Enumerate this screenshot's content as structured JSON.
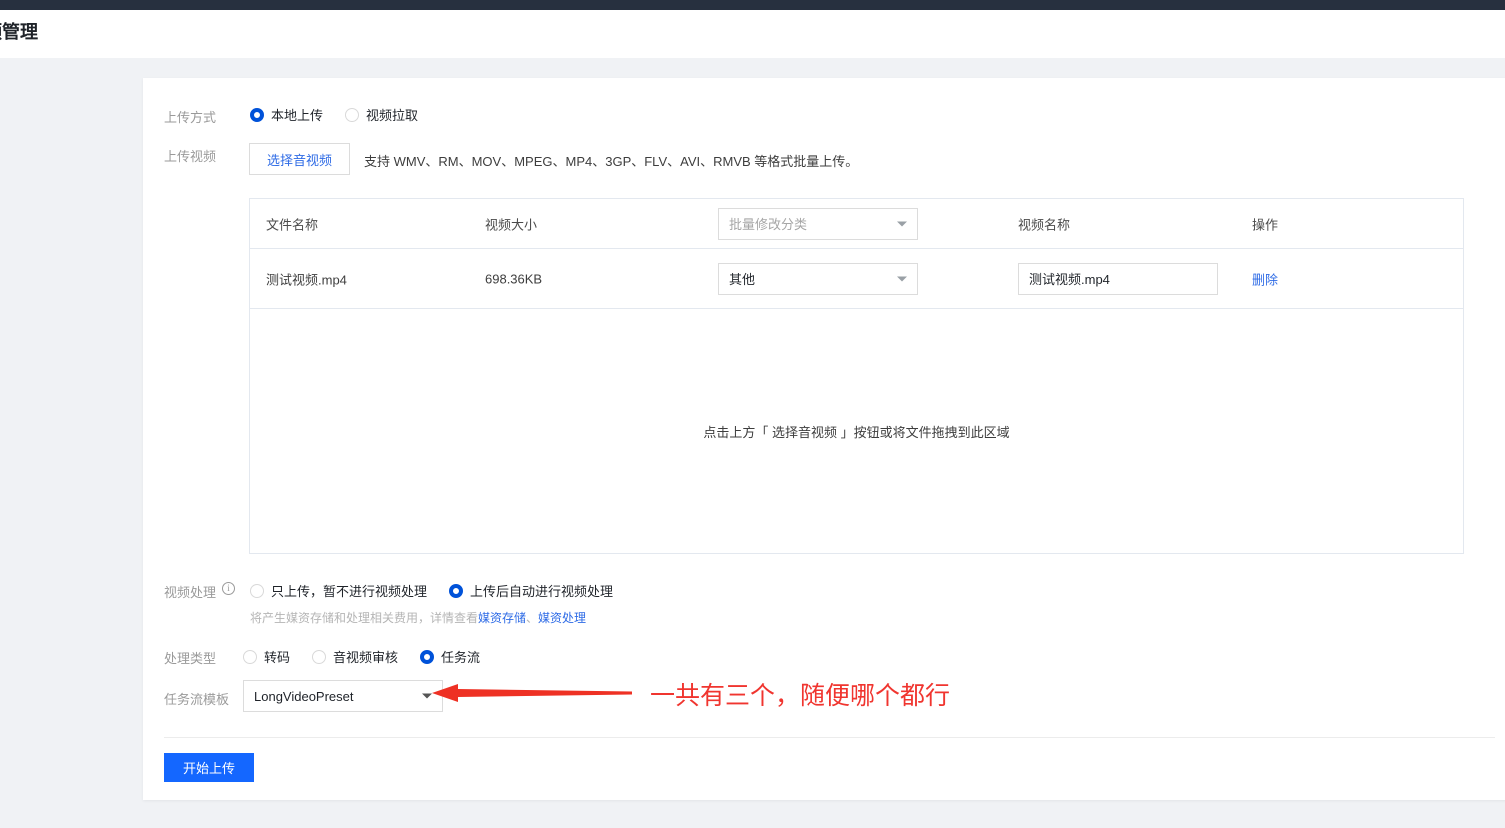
{
  "window": {
    "title": "频管理",
    "topbar_color": "#27303f",
    "page_bg": "#f0f2f5",
    "accent_color": "#1467ff",
    "link_color": "#2e6be6",
    "annotation_color": "#f0352f"
  },
  "form": {
    "upload_method": {
      "label": "上传方式",
      "options": [
        {
          "label": "本地上传",
          "selected": true
        },
        {
          "label": "视频拉取",
          "selected": false
        }
      ]
    },
    "upload_video": {
      "label": "上传视频",
      "choose_button": "选择音视频",
      "hint": "支持 WMV、RM、MOV、MPEG、MP4、3GP、FLV、AVI、RMVB 等格式批量上传。"
    },
    "table": {
      "headers": {
        "file_name": "文件名称",
        "video_size": "视频大小",
        "video_name": "视频名称",
        "action": "操作"
      },
      "batch_category_placeholder": "批量修改分类",
      "rows": [
        {
          "file_name": "测试视频.mp4",
          "video_size": "698.36KB",
          "category": "其他",
          "video_name": "测试视频.mp4",
          "action": "删除"
        }
      ],
      "dropzone_text": "点击上方「 选择音视频 」按钮或将文件拖拽到此区域"
    },
    "video_processing": {
      "label": "视频处理",
      "info_icon": "info-icon",
      "options": [
        {
          "label": "只上传，暂不进行视频处理",
          "selected": false
        },
        {
          "label": "上传后自动进行视频处理",
          "selected": true
        }
      ],
      "note_prefix": "将产生媒资存储和处理相关费用，详情查看",
      "note_link_1": "媒资存储",
      "note_sep": "、",
      "note_link_2": "媒资处理"
    },
    "processing_type": {
      "label": "处理类型",
      "options": [
        {
          "label": "转码",
          "selected": false
        },
        {
          "label": "音视频审核",
          "selected": false
        },
        {
          "label": "任务流",
          "selected": true
        }
      ]
    },
    "task_flow_template": {
      "label": "任务流模板",
      "value": "LongVideoPreset"
    },
    "submit_button": "开始上传"
  },
  "annotation": {
    "text": "一共有三个，随便哪个都行",
    "arrow": "left-arrow-annotation"
  }
}
